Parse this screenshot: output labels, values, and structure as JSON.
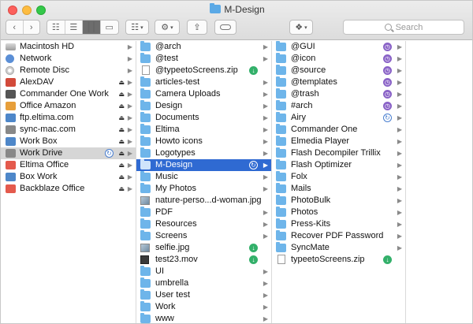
{
  "window": {
    "title": "M-Design"
  },
  "toolbar": {
    "back_icon": "chevron-left-icon",
    "forward_icon": "chevron-right-icon",
    "view_modes": [
      "icon-view-icon",
      "list-view-icon",
      "column-view-icon",
      "cover-flow-icon"
    ],
    "arrange_icon": "arrange-grid-icon",
    "action_icon": "gear-icon",
    "share_icon": "share-icon",
    "tag_icon": "tag-icon",
    "dropbox_icon": "dropbox-icon",
    "search_placeholder": "Search"
  },
  "colors": {
    "selection_blue": "#2f6ad2",
    "folder": "#6eb5ea",
    "sync_green": "#33b06a",
    "sync_purple": "#8a63c7"
  },
  "column1": [
    {
      "label": "Macintosh HD",
      "icon": "hard-drive-icon"
    },
    {
      "label": "Network",
      "icon": "network-globe-icon"
    },
    {
      "label": "Remote Disc",
      "icon": "remote-disc-icon"
    },
    {
      "label": "AlexDAV",
      "icon": "webdav-server-icon",
      "eject": true
    },
    {
      "label": "Commander One Work",
      "icon": "server-icon",
      "eject": true
    },
    {
      "label": "Office Amazon",
      "icon": "amazon-server-icon",
      "eject": true
    },
    {
      "label": "ftp.eltima.com",
      "icon": "ftp-server-icon",
      "eject": true
    },
    {
      "label": "sync-mac.com",
      "icon": "sync-server-icon",
      "eject": true
    },
    {
      "label": "Work Box",
      "icon": "box-server-icon",
      "eject": true
    },
    {
      "label": "Work Drive",
      "icon": "drive-server-icon",
      "eject": true,
      "selected": true,
      "sync": true
    },
    {
      "label": "Eltima Office",
      "icon": "office-server-icon",
      "eject": true
    },
    {
      "label": "Box Work",
      "icon": "box-server-icon",
      "eject": true
    },
    {
      "label": "Backblaze Office",
      "icon": "backblaze-server-icon",
      "eject": true
    }
  ],
  "column2": [
    {
      "label": "@arch",
      "type": "folder"
    },
    {
      "label": "@test",
      "type": "folder"
    },
    {
      "label": "@typeetoScreens.zip",
      "type": "file",
      "status": "download"
    },
    {
      "label": "articles-test",
      "type": "folder"
    },
    {
      "label": "Camera Uploads",
      "type": "folder"
    },
    {
      "label": "Design",
      "type": "folder"
    },
    {
      "label": "Documents",
      "type": "folder"
    },
    {
      "label": "Eltima",
      "type": "folder"
    },
    {
      "label": "Howto icons",
      "type": "folder"
    },
    {
      "label": "Logotypes",
      "type": "folder"
    },
    {
      "label": "M-Design",
      "type": "folder",
      "selected": true,
      "status": "syncing"
    },
    {
      "label": "Music",
      "type": "folder"
    },
    {
      "label": "My Photos",
      "type": "folder"
    },
    {
      "label": "nature-perso...d-woman.jpg",
      "type": "image"
    },
    {
      "label": "PDF",
      "type": "folder"
    },
    {
      "label": "Resources",
      "type": "folder"
    },
    {
      "label": "Screens",
      "type": "folder"
    },
    {
      "label": "selfie.jpg",
      "type": "image",
      "status": "download"
    },
    {
      "label": "test23.mov",
      "type": "movie",
      "status": "download"
    },
    {
      "label": "UI",
      "type": "folder"
    },
    {
      "label": "umbrella",
      "type": "folder"
    },
    {
      "label": "User test",
      "type": "folder"
    },
    {
      "label": "Work",
      "type": "folder"
    },
    {
      "label": "www",
      "type": "folder"
    }
  ],
  "column3": [
    {
      "label": "@GUI",
      "type": "folder",
      "status": "pending"
    },
    {
      "label": "@icon",
      "type": "folder",
      "status": "pending"
    },
    {
      "label": "@source",
      "type": "folder",
      "status": "pending"
    },
    {
      "label": "@templates",
      "type": "folder",
      "status": "pending"
    },
    {
      "label": "@trash",
      "type": "folder",
      "status": "pending"
    },
    {
      "label": "#arch",
      "type": "folder",
      "status": "pending"
    },
    {
      "label": "Airy",
      "type": "folder",
      "status": "syncing"
    },
    {
      "label": "Commander One",
      "type": "folder"
    },
    {
      "label": "Elmedia Player",
      "type": "folder"
    },
    {
      "label": "Flash Decompiler Trillix",
      "type": "folder"
    },
    {
      "label": "Flash Optimizer",
      "type": "folder"
    },
    {
      "label": "Folx",
      "type": "folder"
    },
    {
      "label": "Mails",
      "type": "folder"
    },
    {
      "label": "PhotoBulk",
      "type": "folder"
    },
    {
      "label": "Photos",
      "type": "folder"
    },
    {
      "label": "Press-Kits",
      "type": "folder"
    },
    {
      "label": "Recover PDF Password",
      "type": "folder"
    },
    {
      "label": "SyncMate",
      "type": "folder"
    },
    {
      "label": "typeetoScreens.zip",
      "type": "file",
      "status": "download"
    }
  ]
}
